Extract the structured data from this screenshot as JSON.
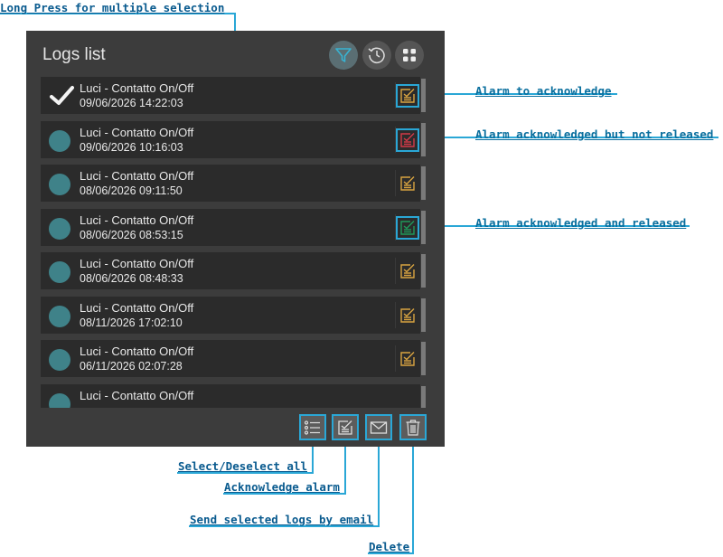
{
  "annotations": {
    "long_press": "Long Press for multiple selection",
    "alarm_to_ack": "Alarm to acknowledge",
    "ack_not_released": "Alarm acknowledged but not released",
    "ack_released": "Alarm acknowledged and released",
    "select_all": "Select/Deselect all",
    "ack_alarm": "Acknowledge alarm",
    "send_email": "Send selected logs by email",
    "delete": "Delete"
  },
  "panel": {
    "title": "Logs list"
  },
  "header_icons": [
    "filter-icon",
    "history-clock-icon",
    "grid-icon"
  ],
  "logs": [
    {
      "name": "Luci - Contatto On/Off",
      "date": "09/06/2026 14:22:03",
      "selected": true,
      "state": "to_acknowledge"
    },
    {
      "name": "Luci - Contatto On/Off",
      "date": "09/06/2026 10:16:03",
      "selected": false,
      "state": "ack_not_released"
    },
    {
      "name": "Luci - Contatto On/Off",
      "date": "08/06/2026 09:11:50",
      "selected": false,
      "state": "to_acknowledge"
    },
    {
      "name": "Luci - Contatto On/Off",
      "date": "08/06/2026 08:53:15",
      "selected": false,
      "state": "ack_released"
    },
    {
      "name": "Luci - Contatto On/Off",
      "date": "08/06/2026 08:48:33",
      "selected": false,
      "state": "to_acknowledge"
    },
    {
      "name": "Luci - Contatto On/Off",
      "date": "08/11/2026 17:02:10",
      "selected": false,
      "state": "to_acknowledge"
    },
    {
      "name": "Luci - Contatto On/Off",
      "date": "06/11/2026 02:07:28",
      "selected": false,
      "state": "to_acknowledge"
    },
    {
      "name": "Luci - Contatto On/Off",
      "date": "",
      "selected": false,
      "state": "none"
    }
  ],
  "colors": {
    "to_acknowledge": "#d9a441",
    "ack_not_released": "#d23a48",
    "ack_released": "#1f9a5a",
    "annotation": "#0a5b8f",
    "callout": "#2aa7d6"
  },
  "footer_icons": [
    "select-all-list-icon",
    "acknowledge-icon",
    "email-icon",
    "trash-icon"
  ]
}
